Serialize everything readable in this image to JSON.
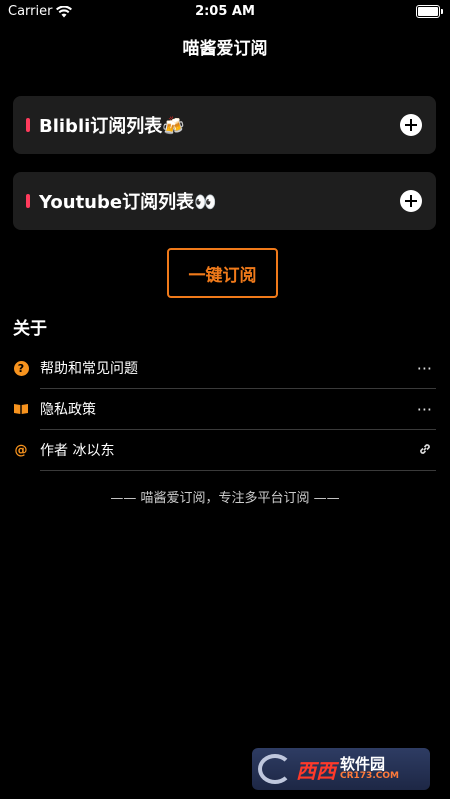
{
  "status_bar": {
    "carrier": "Carrier",
    "time": "2:05 AM"
  },
  "nav": {
    "title": "喵酱爱订阅"
  },
  "cards": [
    {
      "label": "Blibli订阅列表🍻"
    },
    {
      "label": "Youtube订阅列表👀"
    }
  ],
  "subscribe_button": {
    "label": "一键订阅"
  },
  "about": {
    "title": "关于",
    "items": [
      {
        "icon": "help-icon",
        "label": "帮助和常见问题",
        "trailing": "···"
      },
      {
        "icon": "book-icon",
        "label": "隐私政策",
        "trailing": "···"
      },
      {
        "icon": "at-icon",
        "label": "作者 冰以东",
        "trailing": "link-icon"
      }
    ]
  },
  "footer": {
    "text": "—— 喵酱爱订阅，专注多平台订阅 ——"
  },
  "watermark": {
    "brand": "西西软件园",
    "domain": "CR173.COM"
  },
  "colors": {
    "accent": "#f07a1a",
    "marker": "#ff3b5c",
    "card_bg": "#1e1e1e",
    "icon": "#f7931e"
  }
}
